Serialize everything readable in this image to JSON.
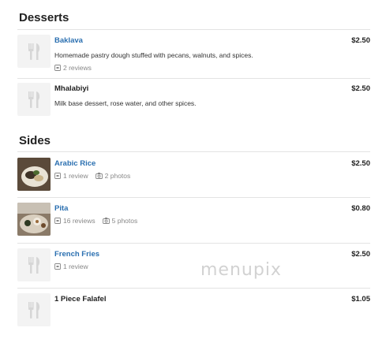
{
  "sections": [
    {
      "title": "Desserts",
      "items": [
        {
          "name": "Baklava",
          "price": "$2.50",
          "description": "Homemade pastry dough stuffed with pecans, walnuts, and spices.",
          "reviews": "2 reviews",
          "photos": null,
          "linked": true
        },
        {
          "name": "Mhalabiyi",
          "price": "$2.50",
          "description": "Milk base dessert, rose water, and other spices.",
          "reviews": null,
          "photos": null,
          "linked": false
        }
      ]
    },
    {
      "title": "Sides",
      "items": [
        {
          "name": "Arabic Rice",
          "price": "$2.50",
          "description": null,
          "reviews": "1 review",
          "photos": "2 photos",
          "linked": true
        },
        {
          "name": "Pita",
          "price": "$0.80",
          "description": null,
          "reviews": "16 reviews",
          "photos": "5 photos",
          "linked": true
        },
        {
          "name": "French Fries",
          "price": "$2.50",
          "description": null,
          "reviews": "1 review",
          "photos": null,
          "linked": true
        },
        {
          "name": "1 Piece Falafel",
          "price": "$1.05",
          "description": null,
          "reviews": null,
          "photos": null,
          "linked": false
        }
      ]
    }
  ],
  "watermark": "menupix",
  "icons": {
    "placeholder": "fork-knife-icon",
    "review": "review-icon",
    "photo": "camera-icon"
  },
  "colors": {
    "link": "#2a6fb0",
    "divider": "#e3e3e3",
    "muted": "#888888"
  }
}
